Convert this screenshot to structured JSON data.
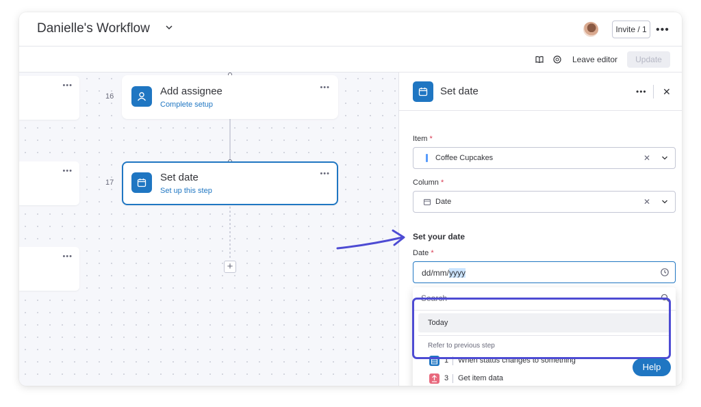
{
  "header": {
    "title": "Danielle's Workflow",
    "invite_label": "Invite / 1"
  },
  "toolbar": {
    "leave_label": "Leave editor",
    "update_label": "Update"
  },
  "canvas": {
    "steps": [
      {
        "number": "16",
        "title": "Add assignee",
        "subtitle": "Complete setup"
      },
      {
        "number": "17",
        "title": "Set date",
        "subtitle": "Set up this step"
      }
    ]
  },
  "panel": {
    "title": "Set date",
    "item_label": "Item",
    "item_value": "Coffee Cupcakes",
    "column_label": "Column",
    "column_value": "Date",
    "section_title": "Set your date",
    "date_label": "Date",
    "date_value_prefix": "dd/mm/",
    "date_value_selected": "yyyy",
    "required_mark": "*"
  },
  "dropdown": {
    "search_placeholder": "Search",
    "today_label": "Today",
    "refer_label": "Refer to previous step",
    "options": [
      {
        "number": "1",
        "text": "When status changes to something",
        "icon": "list-icon",
        "color": "#1f76c2"
      },
      {
        "number": "3",
        "text": "Get item data",
        "icon": "upload-icon",
        "color": "#e8697d"
      }
    ]
  },
  "help_label": "Help",
  "colors": {
    "primary": "#1f76c2",
    "highlight": "#4d4bd3",
    "required": "#d83a52"
  }
}
